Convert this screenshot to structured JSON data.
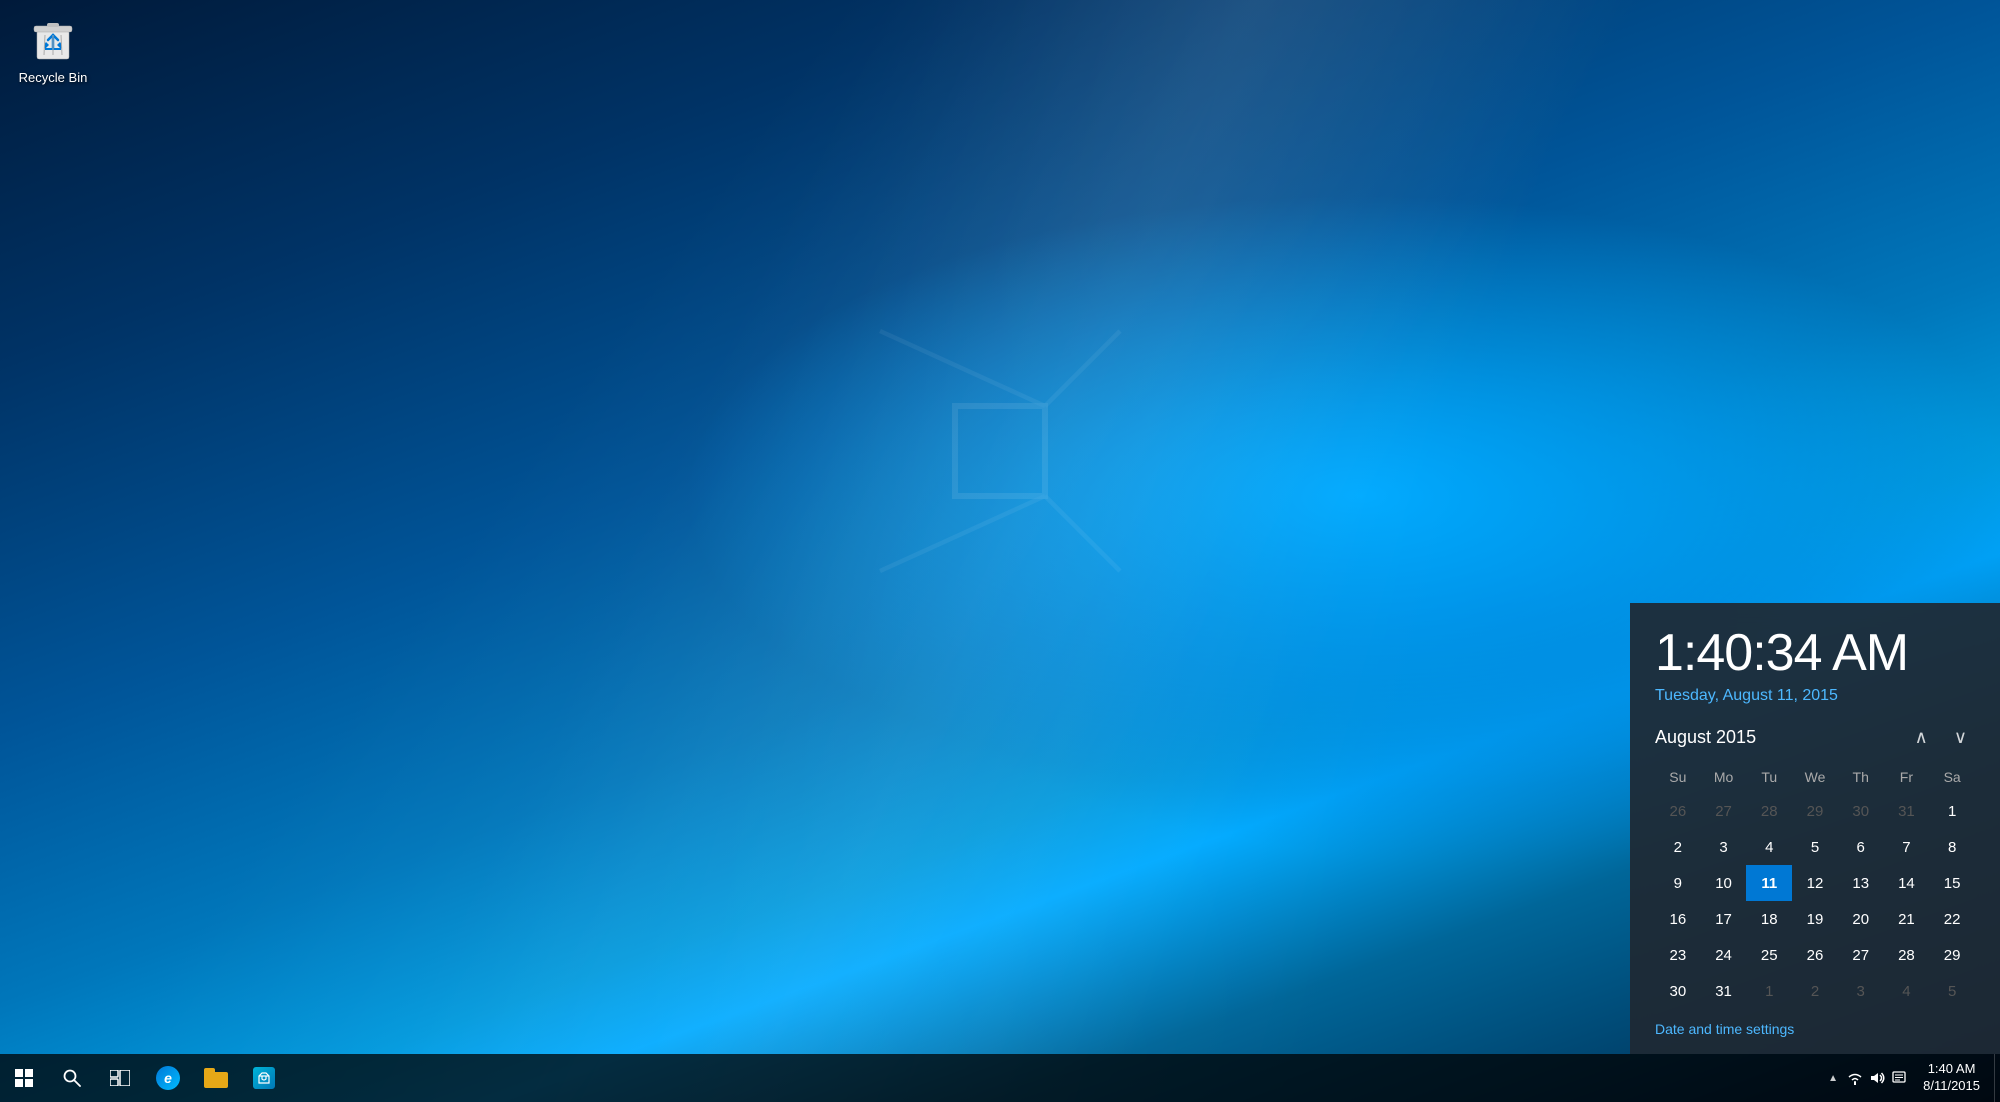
{
  "desktop": {
    "background_desc": "Windows 10 hero wallpaper blue"
  },
  "recycle_bin": {
    "label": "Recycle Bin"
  },
  "calendar_popup": {
    "time": "1:40:34 AM",
    "date": "Tuesday, August 11, 2015",
    "month_year": "August 2015",
    "nav_prev": "∧",
    "nav_next": "∨",
    "day_headers": [
      "Su",
      "Mo",
      "Tu",
      "We",
      "Th",
      "Fr",
      "Sa"
    ],
    "weeks": [
      [
        {
          "day": "26",
          "type": "other-month"
        },
        {
          "day": "27",
          "type": "other-month"
        },
        {
          "day": "28",
          "type": "other-month"
        },
        {
          "day": "29",
          "type": "other-month"
        },
        {
          "day": "30",
          "type": "other-month"
        },
        {
          "day": "31",
          "type": "other-month"
        },
        {
          "day": "1",
          "type": "normal"
        }
      ],
      [
        {
          "day": "2",
          "type": "normal"
        },
        {
          "day": "3",
          "type": "normal"
        },
        {
          "day": "4",
          "type": "normal"
        },
        {
          "day": "5",
          "type": "normal"
        },
        {
          "day": "6",
          "type": "normal"
        },
        {
          "day": "7",
          "type": "normal"
        },
        {
          "day": "8",
          "type": "normal"
        }
      ],
      [
        {
          "day": "9",
          "type": "normal"
        },
        {
          "day": "10",
          "type": "normal"
        },
        {
          "day": "11",
          "type": "today"
        },
        {
          "day": "12",
          "type": "normal"
        },
        {
          "day": "13",
          "type": "normal"
        },
        {
          "day": "14",
          "type": "normal"
        },
        {
          "day": "15",
          "type": "normal"
        }
      ],
      [
        {
          "day": "16",
          "type": "normal"
        },
        {
          "day": "17",
          "type": "normal"
        },
        {
          "day": "18",
          "type": "normal"
        },
        {
          "day": "19",
          "type": "normal"
        },
        {
          "day": "20",
          "type": "normal"
        },
        {
          "day": "21",
          "type": "normal"
        },
        {
          "day": "22",
          "type": "normal"
        }
      ],
      [
        {
          "day": "23",
          "type": "normal"
        },
        {
          "day": "24",
          "type": "normal"
        },
        {
          "day": "25",
          "type": "normal"
        },
        {
          "day": "26",
          "type": "normal"
        },
        {
          "day": "27",
          "type": "normal"
        },
        {
          "day": "28",
          "type": "normal"
        },
        {
          "day": "29",
          "type": "normal"
        }
      ],
      [
        {
          "day": "30",
          "type": "normal"
        },
        {
          "day": "31",
          "type": "normal"
        },
        {
          "day": "1",
          "type": "other-month"
        },
        {
          "day": "2",
          "type": "other-month"
        },
        {
          "day": "3",
          "type": "other-month"
        },
        {
          "day": "4",
          "type": "other-month"
        },
        {
          "day": "5",
          "type": "other-month"
        }
      ]
    ],
    "settings_link": "Date and time settings"
  },
  "taskbar": {
    "clock_time": "1:40 AM",
    "clock_date": "8/11/2015",
    "start_label": "Start",
    "search_label": "Search",
    "task_view_label": "Task View",
    "edge_label": "Microsoft Edge",
    "explorer_label": "File Explorer",
    "store_label": "Store"
  }
}
